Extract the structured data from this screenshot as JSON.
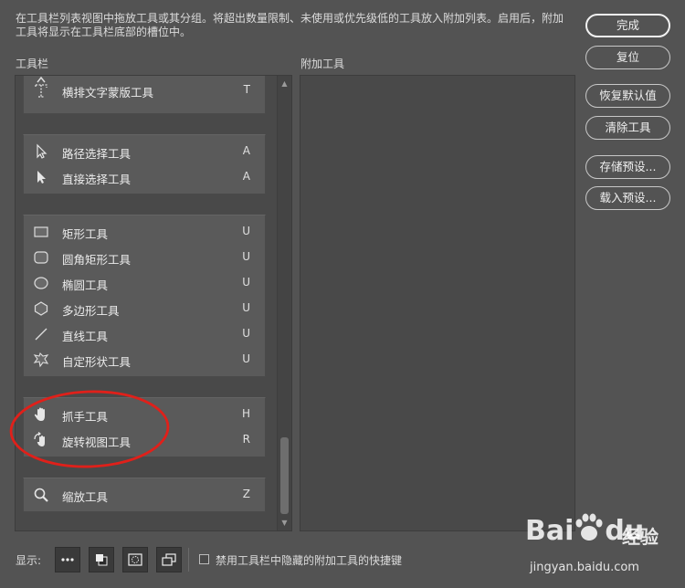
{
  "description": "在工具栏列表视图中拖放工具或其分组。将超出数量限制、未使用或优先级低的工具放入附加列表。启用后，附加工具将显示在工具栏底部的槽位中。",
  "toolbar_label": "工具栏",
  "extra_label": "附加工具",
  "groups": [
    {
      "tools": [
        {
          "icon": "partial-tool-icon",
          "name": "",
          "key": ""
        },
        {
          "icon": "horizontal-type-mask-icon",
          "name": "横排文字蒙版工具",
          "key": "T"
        }
      ]
    },
    {
      "tools": [
        {
          "icon": "path-select-icon",
          "name": "路径选择工具",
          "key": "A"
        },
        {
          "icon": "direct-select-icon",
          "name": "直接选择工具",
          "key": "A"
        }
      ]
    },
    {
      "tools": [
        {
          "icon": "rectangle-icon",
          "name": "矩形工具",
          "key": "U"
        },
        {
          "icon": "rounded-rectangle-icon",
          "name": "圆角矩形工具",
          "key": "U"
        },
        {
          "icon": "ellipse-icon",
          "name": "椭圆工具",
          "key": "U"
        },
        {
          "icon": "polygon-icon",
          "name": "多边形工具",
          "key": "U"
        },
        {
          "icon": "line-icon",
          "name": "直线工具",
          "key": "U"
        },
        {
          "icon": "custom-shape-icon",
          "name": "自定形状工具",
          "key": "U"
        }
      ]
    },
    {
      "tools": [
        {
          "icon": "hand-icon",
          "name": "抓手工具",
          "key": "H"
        },
        {
          "icon": "rotate-view-icon",
          "name": "旋转视图工具",
          "key": "R"
        }
      ]
    },
    {
      "tools": [
        {
          "icon": "zoom-icon",
          "name": "缩放工具",
          "key": "Z"
        }
      ]
    }
  ],
  "buttons": {
    "done": "完成",
    "reset": "复位",
    "restore_defaults": "恢复默认值",
    "clear_tools": "清除工具",
    "save_preset": "存储预设...",
    "load_preset": "载入预设..."
  },
  "show_label": "显示:",
  "checkbox_label": "禁用工具栏中隐藏的附加工具的快捷键",
  "checkbox_checked": false,
  "watermark": {
    "brand": "Bai",
    "brand2": "du",
    "cn": "经验",
    "url": "jingyan.baidu.com"
  },
  "annotation_color": "#e0201a"
}
